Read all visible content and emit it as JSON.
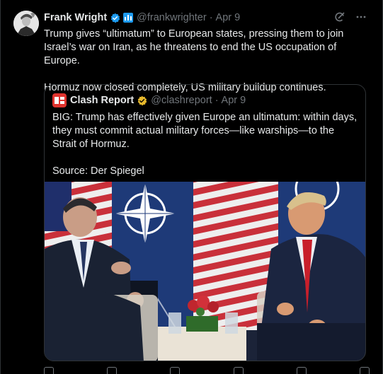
{
  "tweet": {
    "author_name": "Frank Wright",
    "handle": "@frankwrighter",
    "dot": "·",
    "date": "Apr 9",
    "lines": [
      "Trump gives “ultimatum” to European states, pressing them to join Israel’s war on Iran, as he threatens to end the US occupation of Europe.",
      "Hormuz now closed completely, US military buildup continues."
    ]
  },
  "quote": {
    "author_name": "Clash Report",
    "handle": "@clashreport",
    "dot": "·",
    "date": "Apr 9",
    "lines": [
      "BIG: Trump has effectively given Europe an ultimatum: within days, they must commit actual military forces—like warships—to the Strait of Hormuz.",
      "Source: Der Spiegel"
    ]
  },
  "colors": {
    "background": "#000000",
    "text": "#e7e9ea",
    "muted": "#71767b",
    "verified_blue": "#1d9bf0",
    "verified_gold": "#e8b92c",
    "border": "#2f3336"
  },
  "icons": [
    "verified-icon",
    "affiliate-badge-icon",
    "grok-icon",
    "more-icon",
    "clash-report-logo",
    "gold-verified-icon"
  ]
}
